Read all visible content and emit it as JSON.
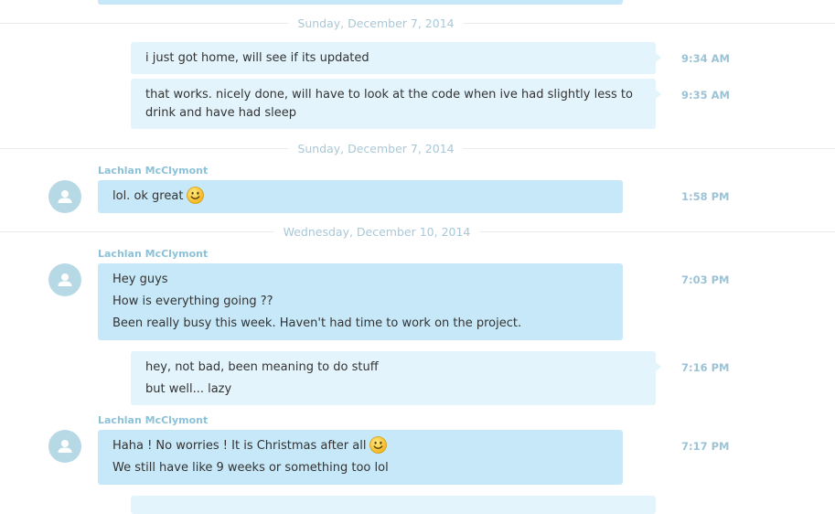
{
  "conversation": {
    "dates": {
      "d1": "Sunday, December 7, 2014",
      "d2": "Sunday, December 7, 2014",
      "d3": "Wednesday, December 10, 2014"
    },
    "messages": [
      {
        "direction": "outgoing",
        "lines": [
          "i just got home, will see if its updated"
        ],
        "time": "9:34 AM"
      },
      {
        "direction": "outgoing",
        "lines": [
          "that works. nicely done, will have to look at the code when ive had slightly less to drink and have had sleep"
        ],
        "time": "9:35 AM"
      },
      {
        "direction": "incoming",
        "sender": "Lachlan McClymont",
        "lines": [
          "lol. ok great"
        ],
        "time": "1:58 PM",
        "emoji": "smile-emoji"
      },
      {
        "direction": "incoming",
        "sender": "Lachlan McClymont",
        "lines": [
          "Hey guys",
          "How is everything going ??",
          "Been really busy this week. Haven't had time to work on the project."
        ],
        "time": "7:03 PM"
      },
      {
        "direction": "outgoing",
        "lines": [
          "hey, not bad, been meaning to do stuff",
          "but well... lazy"
        ],
        "time": "7:16 PM"
      },
      {
        "direction": "incoming",
        "sender": "Lachlan McClymont",
        "lines": [
          "Haha ! No worries !  It is Christmas after all",
          "We still have like 9 weeks or something too lol"
        ],
        "time": "7:17 PM",
        "emoji": "smile-emoji"
      }
    ]
  },
  "colors": {
    "incoming_bubble": "#c7e8f8",
    "outgoing_bubble": "#e3f4fc",
    "date_text": "#a9c8d6",
    "time_text": "#9cc3d5",
    "sender_text": "#8cc2d8",
    "avatar_bg": "#b7d9e6"
  }
}
